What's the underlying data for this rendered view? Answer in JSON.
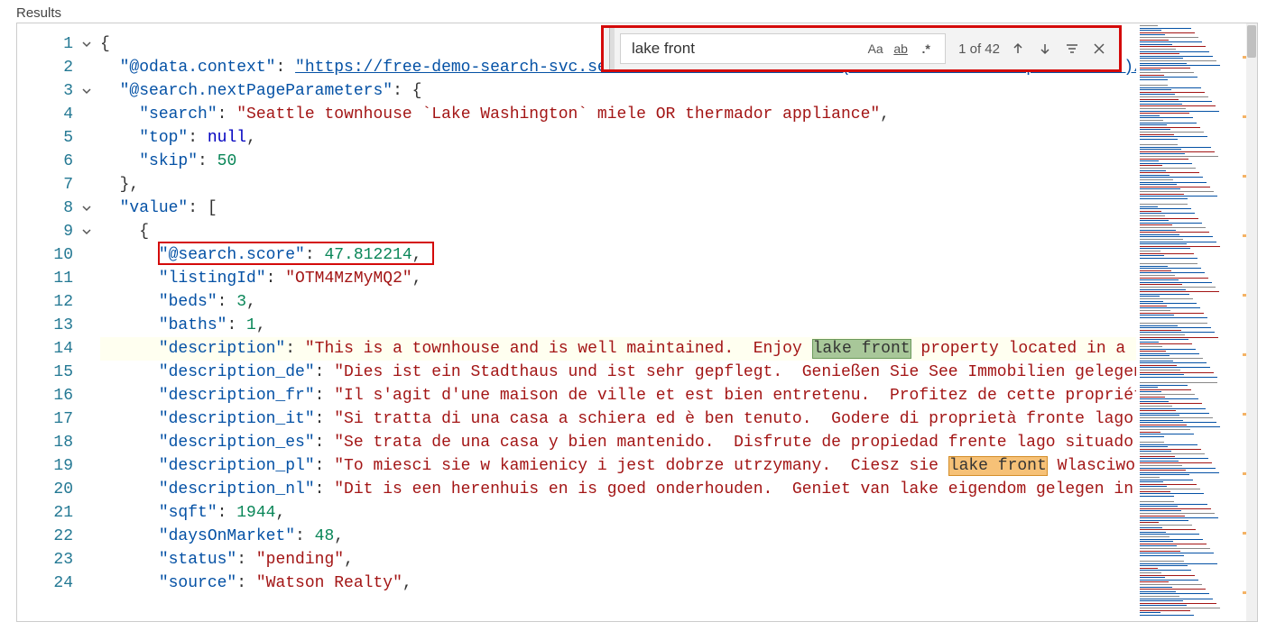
{
  "title": "Results",
  "find": {
    "value": "lake front",
    "count": "1 of 42",
    "icons": {
      "case": "Aa",
      "word": "ab",
      "regex": ".*"
    }
  },
  "lines": [
    {
      "n": 1,
      "fold": true,
      "indent": 0,
      "tokens": [
        {
          "t": "brc",
          "v": "{"
        }
      ]
    },
    {
      "n": 2,
      "indent": 1,
      "tokens": [
        {
          "t": "key",
          "v": "\"@odata.context\""
        },
        {
          "t": "brc",
          "v": ": "
        },
        {
          "t": "url",
          "v": "\"https://free-demo-search-svc.search.windows.net/indexes('realestate-us-sample-index')/$meta"
        }
      ]
    },
    {
      "n": 3,
      "fold": true,
      "indent": 1,
      "tokens": [
        {
          "t": "key",
          "v": "\"@search.nextPageParameters\""
        },
        {
          "t": "brc",
          "v": ": {"
        }
      ]
    },
    {
      "n": 4,
      "indent": 2,
      "tokens": [
        {
          "t": "key",
          "v": "\"search\""
        },
        {
          "t": "brc",
          "v": ": "
        },
        {
          "t": "str",
          "v": "\"Seattle townhouse `Lake Washington` miele OR thermador appliance\""
        },
        {
          "t": "brc",
          "v": ","
        }
      ]
    },
    {
      "n": 5,
      "indent": 2,
      "tokens": [
        {
          "t": "key",
          "v": "\"top\""
        },
        {
          "t": "brc",
          "v": ": "
        },
        {
          "t": "nul",
          "v": "null"
        },
        {
          "t": "brc",
          "v": ","
        }
      ]
    },
    {
      "n": 6,
      "indent": 2,
      "tokens": [
        {
          "t": "key",
          "v": "\"skip\""
        },
        {
          "t": "brc",
          "v": ": "
        },
        {
          "t": "num",
          "v": "50"
        }
      ]
    },
    {
      "n": 7,
      "indent": 1,
      "tokens": [
        {
          "t": "brc",
          "v": "},"
        }
      ]
    },
    {
      "n": 8,
      "fold": true,
      "indent": 1,
      "tokens": [
        {
          "t": "key",
          "v": "\"value\""
        },
        {
          "t": "brc",
          "v": ": ["
        }
      ]
    },
    {
      "n": 9,
      "fold": true,
      "indent": 2,
      "tokens": [
        {
          "t": "brc",
          "v": "{"
        }
      ]
    },
    {
      "n": 10,
      "indent": 3,
      "tokens": [
        {
          "t": "key",
          "v": "\"@search.score\""
        },
        {
          "t": "brc",
          "v": ": "
        },
        {
          "t": "num",
          "v": "47.812214"
        },
        {
          "t": "brc",
          "v": ","
        }
      ]
    },
    {
      "n": 11,
      "indent": 3,
      "tokens": [
        {
          "t": "key",
          "v": "\"listingId\""
        },
        {
          "t": "brc",
          "v": ": "
        },
        {
          "t": "str",
          "v": "\"OTM4MzMyMQ2\""
        },
        {
          "t": "brc",
          "v": ","
        }
      ]
    },
    {
      "n": 12,
      "indent": 3,
      "tokens": [
        {
          "t": "key",
          "v": "\"beds\""
        },
        {
          "t": "brc",
          "v": ": "
        },
        {
          "t": "num",
          "v": "3"
        },
        {
          "t": "brc",
          "v": ","
        }
      ]
    },
    {
      "n": 13,
      "indent": 3,
      "tokens": [
        {
          "t": "key",
          "v": "\"baths\""
        },
        {
          "t": "brc",
          "v": ": "
        },
        {
          "t": "num",
          "v": "1"
        },
        {
          "t": "brc",
          "v": ","
        }
      ]
    },
    {
      "n": 14,
      "hl": true,
      "indent": 3,
      "tokens": [
        {
          "t": "key",
          "v": "\"description\""
        },
        {
          "t": "brc",
          "v": ": "
        },
        {
          "t": "str",
          "v": "\"This is a townhouse and is well maintained.  Enjoy "
        },
        {
          "t": "match-cur",
          "v": "lake front"
        },
        {
          "t": "str",
          "v": " property located in a cul-d"
        }
      ]
    },
    {
      "n": 15,
      "indent": 3,
      "tokens": [
        {
          "t": "key",
          "v": "\"description_de\""
        },
        {
          "t": "brc",
          "v": ": "
        },
        {
          "t": "str",
          "v": "\"Dies ist ein Stadthaus und ist sehr gepflegt.  Genießen Sie See Immobilien gelegen in "
        }
      ]
    },
    {
      "n": 16,
      "indent": 3,
      "tokens": [
        {
          "t": "key",
          "v": "\"description_fr\""
        },
        {
          "t": "brc",
          "v": ": "
        },
        {
          "t": "str",
          "v": "\"Il s'agit d'une maison de ville et est bien entretenu.  Profitez de cette propriété fr"
        }
      ]
    },
    {
      "n": 17,
      "indent": 3,
      "tokens": [
        {
          "t": "key",
          "v": "\"description_it\""
        },
        {
          "t": "brc",
          "v": ": "
        },
        {
          "t": "str",
          "v": "\"Si tratta di una casa a schiera ed è ben tenuto.  Godere di proprietà fronte lago Situ"
        }
      ]
    },
    {
      "n": 18,
      "indent": 3,
      "tokens": [
        {
          "t": "key",
          "v": "\"description_es\""
        },
        {
          "t": "brc",
          "v": ": "
        },
        {
          "t": "str",
          "v": "\"Se trata de una casa y bien mantenido.  Disfrute de propiedad frente lago situado en u"
        }
      ]
    },
    {
      "n": 19,
      "indent": 3,
      "tokens": [
        {
          "t": "key",
          "v": "\"description_pl\""
        },
        {
          "t": "brc",
          "v": ": "
        },
        {
          "t": "str",
          "v": "\"To miesci sie w kamienicy i jest dobrze utrzymany.  Ciesz sie "
        },
        {
          "t": "match",
          "v": "lake front"
        },
        {
          "t": "str",
          "v": " Wlasciwosc po"
        }
      ]
    },
    {
      "n": 20,
      "indent": 3,
      "tokens": [
        {
          "t": "key",
          "v": "\"description_nl\""
        },
        {
          "t": "brc",
          "v": ": "
        },
        {
          "t": "str",
          "v": "\"Dit is een herenhuis en is goed onderhouden.  Geniet van lake eigendom gelegen in een "
        }
      ]
    },
    {
      "n": 21,
      "indent": 3,
      "tokens": [
        {
          "t": "key",
          "v": "\"sqft\""
        },
        {
          "t": "brc",
          "v": ": "
        },
        {
          "t": "num",
          "v": "1944"
        },
        {
          "t": "brc",
          "v": ","
        }
      ]
    },
    {
      "n": 22,
      "indent": 3,
      "tokens": [
        {
          "t": "key",
          "v": "\"daysOnMarket\""
        },
        {
          "t": "brc",
          "v": ": "
        },
        {
          "t": "num",
          "v": "48"
        },
        {
          "t": "brc",
          "v": ","
        }
      ]
    },
    {
      "n": 23,
      "indent": 3,
      "tokens": [
        {
          "t": "key",
          "v": "\"status\""
        },
        {
          "t": "brc",
          "v": ": "
        },
        {
          "t": "str",
          "v": "\"pending\""
        },
        {
          "t": "brc",
          "v": ","
        }
      ]
    },
    {
      "n": 24,
      "indent": 3,
      "tokens": [
        {
          "t": "key",
          "v": "\"source\""
        },
        {
          "t": "brc",
          "v": ": "
        },
        {
          "t": "str",
          "v": "\"Watson Realty\""
        },
        {
          "t": "brc",
          "v": ","
        }
      ]
    }
  ]
}
